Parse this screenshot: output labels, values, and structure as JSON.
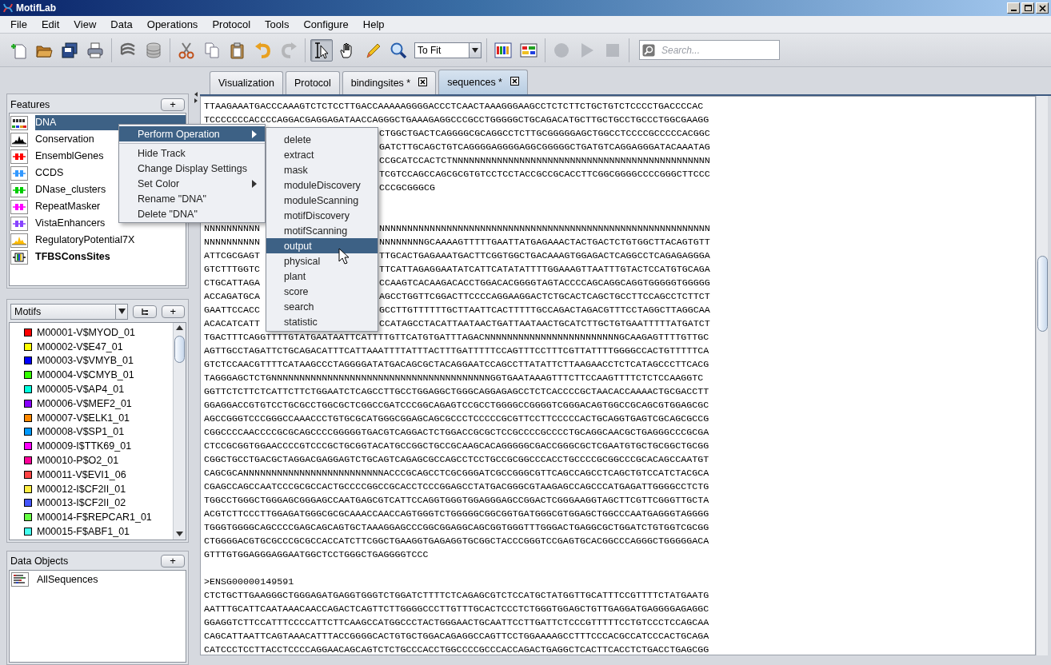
{
  "window": {
    "title": "MotifLab"
  },
  "menu_bar": [
    "File",
    "Edit",
    "View",
    "Data",
    "Operations",
    "Protocol",
    "Tools",
    "Configure",
    "Help"
  ],
  "toolbar": {
    "groups": [
      {
        "items": [
          {
            "kind": "new",
            "disabled": false
          },
          {
            "kind": "open",
            "disabled": false
          },
          {
            "kind": "save",
            "disabled": false
          },
          {
            "kind": "print",
            "disabled": false
          }
        ]
      },
      {
        "items": [
          {
            "kind": "layers",
            "disabled": false
          },
          {
            "kind": "database",
            "disabled": false
          }
        ]
      },
      {
        "items": [
          {
            "kind": "cut",
            "disabled": false
          },
          {
            "kind": "copy",
            "disabled": false
          },
          {
            "kind": "paste",
            "disabled": false
          },
          {
            "kind": "undo",
            "disabled": false
          },
          {
            "kind": "redo",
            "disabled": true
          }
        ]
      },
      {
        "items": [
          {
            "kind": "select",
            "selected": true
          },
          {
            "kind": "hand",
            "selected": false
          },
          {
            "kind": "pencil",
            "selected": false
          },
          {
            "kind": "zoom",
            "selected": false
          }
        ],
        "dropdown": {
          "value": "To Fit"
        }
      },
      {
        "items": [
          {
            "kind": "color_bars",
            "disabled": false
          },
          {
            "kind": "tracks",
            "disabled": false
          }
        ]
      },
      {
        "items": [
          {
            "kind": "record",
            "disabled": true
          },
          {
            "kind": "play",
            "disabled": true
          },
          {
            "kind": "stop",
            "disabled": true
          }
        ]
      }
    ],
    "search": {
      "placeholder": "Search..."
    }
  },
  "tabs": [
    {
      "label": "Visualization",
      "selected": false,
      "closable": false
    },
    {
      "label": "Protocol",
      "selected": false,
      "closable": false
    },
    {
      "label": "bindingsites *",
      "selected": false,
      "closable": true
    },
    {
      "label": "sequences *",
      "selected": true,
      "closable": true
    }
  ],
  "features": {
    "title": "Features",
    "add_button": "+",
    "items": [
      {
        "name": "DNA",
        "kind": "sequence",
        "selected": true,
        "bold": false
      },
      {
        "name": "Conservation",
        "kind": "numeric",
        "color": "#000000",
        "selected": false,
        "bold": false
      },
      {
        "name": "EnsemblGenes",
        "kind": "region",
        "color": "#ff0000",
        "selected": false,
        "bold": false
      },
      {
        "name": "CCDS",
        "kind": "region",
        "color": "#3399ff",
        "selected": false,
        "bold": false
      },
      {
        "name": "DNase_clusters",
        "kind": "region",
        "color": "#00cc00",
        "selected": false,
        "bold": false
      },
      {
        "name": "RepeatMasker",
        "kind": "region",
        "color": "#ff00ff",
        "selected": false,
        "bold": false
      },
      {
        "name": "VistaEnhancers",
        "kind": "region",
        "color": "#8844ff",
        "selected": false,
        "bold": false
      },
      {
        "name": "RegulatoryPotential7X",
        "kind": "numeric",
        "color": "#ffbb00",
        "selected": false,
        "bold": false
      },
      {
        "name": "TFBSConsSites",
        "kind": "motif_track",
        "selected": false,
        "bold": true
      }
    ]
  },
  "motifs": {
    "selector": {
      "value": "Motifs"
    },
    "add_button": "+",
    "items": [
      {
        "name": "M00001-V$MYOD_01",
        "color": "#ff0000"
      },
      {
        "name": "M00002-V$E47_01",
        "color": "#ffff00"
      },
      {
        "name": "M00003-V$VMYB_01",
        "color": "#0000ff"
      },
      {
        "name": "M00004-V$CMYB_01",
        "color": "#33ff00"
      },
      {
        "name": "M00005-V$AP4_01",
        "color": "#00ffdd"
      },
      {
        "name": "M00006-V$MEF2_01",
        "color": "#8800ff"
      },
      {
        "name": "M00007-V$ELK1_01",
        "color": "#ff8800"
      },
      {
        "name": "M00008-V$SP1_01",
        "color": "#0099ff"
      },
      {
        "name": "M00009-I$TTK69_01",
        "color": "#ff00ff"
      },
      {
        "name": "M00010-P$O2_01",
        "color": "#ff0099"
      },
      {
        "name": "M00011-V$EVI1_06",
        "color": "#ff4444"
      },
      {
        "name": "M00012-I$CF2II_01",
        "color": "#ffee44"
      },
      {
        "name": "M00013-I$CF2II_02",
        "color": "#4455ff"
      },
      {
        "name": "M00014-F$REPCAR1_01",
        "color": "#66ff44"
      },
      {
        "name": "M00015-F$ABF1_01",
        "color": "#44ffee"
      }
    ]
  },
  "data_objects": {
    "title": "Data Objects",
    "add_button": "+",
    "items": [
      {
        "name": "AllSequences",
        "kind": "sequence_collection"
      }
    ]
  },
  "sequence_view": {
    "lines": [
      {
        "kind": "full",
        "text": "TTAAGAAATGACCCAAAGTCTCTCCTTGACCAAAAAGGGGACCCTCAACTAAAGGGAAGCCTCTCTTCTGCTGTCTCCCCTGACCCCAC"
      },
      {
        "kind": "full",
        "text": "TCCCCCCCACCCCAGGACGAGGAGATAACCAGGGCTGAAAGAGGCCCGCCTGGGGGCTGCAGACATGCTTGCTGCCTGCCCTGGCGAAGG"
      },
      {
        "kind": "split",
        "right": "CTGGCTGACTCAGGGGCGCAGGCCTCTTGCGGGGGAGCTGGCCTCCCCGCCCCCACGGC"
      },
      {
        "kind": "split",
        "right": "GATCTTGCAGCTGTCAGGGGAGGGGAGGCGGGGGCTGATGTCAGGAGGGATACAAATAG"
      },
      {
        "kind": "split",
        "right": "CCGCATCCACTCTNNNNNNNNNNNNNNNNNNNNNNNNNNNNNNNNNNNNNNNNNNNNNN"
      },
      {
        "kind": "split",
        "right": "TCGTCCAGCCAGCGCGTGTCCTCCTACCGCCGCACCTTCGGCGGGGCCCCGGGCTTCCC"
      },
      {
        "kind": "split",
        "right": "CCCGCGGGCG"
      },
      {
        "kind": "blank"
      },
      {
        "kind": "blank"
      },
      {
        "kind": "split",
        "left": "NNNNNNNNNN",
        "right": "NNNNNNNNNNNNNNNNNNNNNNNNNNNNNNNNNNNNNNNNNNNNNNNNNNNNNNNNNNN"
      },
      {
        "kind": "split",
        "left": "NNNNNNNNNN",
        "right": "NNNNNNNNGCAAAAGTTTTTGAATTATGAGAAACTACTGACTCTGTGGCTTACAGTGTT"
      },
      {
        "kind": "split",
        "left": "ATTCGCGAGT",
        "right": "TTGCACTGAGAAATGACTTCGGTGGCTGACAAAGTGGAGACTCAGGCCTCAGAGAGGGA"
      },
      {
        "kind": "split",
        "left": "GTCTTTGGTC",
        "right": "TTCATTAGAGGAATATCATTCATATATTTTGGAAAGTTAATTTGTACTCCATGTGCAGA"
      },
      {
        "kind": "split",
        "left": "CTGCATTAGA",
        "right": "CCAAGTCACAAGACACCTGGACACGGGGTAGTACCCCAGCAGGCAGGTGGGGGTGGGGG"
      },
      {
        "kind": "split",
        "left": "ACCAGATGCA",
        "right": "AGCCTGGTTCGGACTTCCCCAGGAAGGACTCTGCACTCAGCTGCCTTCCAGCCTCTTCT"
      },
      {
        "kind": "split",
        "left": "GAATTCCACC",
        "right": "GCCTTGTTTTTTGCTTAATTCACTTTTTGCCAGACTAGACGTTTCCTAGGCTTAGGCAA"
      },
      {
        "kind": "split",
        "left": "ACACATCATT",
        "right": "CCATAGCCTACATTAATAACTGATTAATAACTGCATCTTGCTGTGAATTTTTATGATCT"
      },
      {
        "kind": "full",
        "text": "TGACTTTCAGGTTTTGTATGAATAATTCATTTTGTTCATGTGATTTAGACNNNNNNNNNNNNNNNNNNNNNNNNGCAAGAGTTTTGTTGC"
      },
      {
        "kind": "full",
        "text": "AGTTGCCTAGATTCTGCAGACATTTCATTAAATTTTATTTACTTTGATTTTTCCAGTTTCCTTTCGTTATTTTGGGGCCACTGTTTTTCA"
      },
      {
        "kind": "full",
        "text": "GTCTCCAACGTTTTCATAAGCCCTAGGGGATATGACAGCGCTACAGGAATCCAGCCTTATATTCTTAAGAACCTCTCATAGCCCTTCACG"
      },
      {
        "kind": "full",
        "text": "TAGGGAGCTCTGNNNNNNNNNNNNNNNNNNNNNNNNNNNNNNNNNNNNNNNGGTGAATAAAGTTTCTTCCAAGTTTTCTCTCCAAGGTC"
      },
      {
        "kind": "full",
        "text": "GGTTCTCTTCTCATTCTTCTGGAATCTCAGCCTTGCCTGGAGGCTGGGCAGGAGAGCCTCTCACCCCGCTAACACCAAAACTGCGACCTT"
      },
      {
        "kind": "full",
        "text": "GGAGGACCGTGTCCTGCGCCTGGCGCTCGGCCGATCCCGGCAGAGTCCGCCTGGGGCCGGGGTCGGGACAGTGGCCGCAGCGTGGAGCGC"
      },
      {
        "kind": "full",
        "text": "AGCCGGGTCCCGGGCCAAACCCTGTGCGCATGGGCGGAGCAGCGCCCTCCCCCGCGTTCCTTCCCCCACTGCAGGTGAGTCGCAGCGCCG"
      },
      {
        "kind": "full",
        "text": "CGGCCCCAACCCCGCGCAGCCCCGGGGGTGACGTCAGGACTCTGGACCGCGCTCCGCCCCGCCCCTGCAGGCAACGCTGAGGGCCCGCGA"
      },
      {
        "kind": "full",
        "text": "CTCCGCGGTGGAACCCCGTCCCGCTGCGGTACATGCCGGCTGCCGCAAGCACAGGGGGCGACCGGGCGCTCGAATGTGCTGCGGCTGCGG"
      },
      {
        "kind": "full",
        "text": "CGGCTGCCTGACGCTAGGACGAGGAGTCTGCAGTCAGAGCGCCAGCCTCCTGCCGCGGCCCACCTGCCCCGCGGCCCGCACAGCCAATGT"
      },
      {
        "kind": "full",
        "text": "CAGCGCANNNNNNNNNNNNNNNNNNNNNNNNNACCCGCAGCCTCGCGGGATCGCCGGGCGTTCAGCCAGCCTCAGCTGTCCATCTACGCA"
      },
      {
        "kind": "full",
        "text": "CGAGCCAGCCAATCCCGCGCCACTGCCCCGGCCGCACCTCCCGGAGCCTATGACGGGCGTAAGAGCCAGCCCATGAGATTGGGGCCTCTG"
      },
      {
        "kind": "full",
        "text": "TGGCCTGGGCTGGGAGCGGGAGCCAATGAGCGTCATTCCAGGTGGGTGGAGGGAGCCGGACTCGGGAAGGTAGCTTCGTTCGGGTTGCTA"
      },
      {
        "kind": "full",
        "text": "ACGTCTTCCCTTGGAGATGGGCGCGCAAACCAACCAGTGGGTCTGGGGGCGGCGGTGATGGGCGTGGAGCTGGCCCAATGAGGGTAGGGG"
      },
      {
        "kind": "full",
        "text": "TGGGTGGGGCAGCCCCGAGCAGCAGTGCTAAAGGAGCCCGGCGGAGGCAGCGGTGGGTTTGGGACTGAGGCGCTGGATCTGTGGTCGCGG"
      },
      {
        "kind": "full",
        "text": "CTGGGGACGTGCGCCCGCGCCACCATCTTCGGCTGAAGGTGAGAGGTGCGGCTACCCGGGTCCGAGTGCACGGCCCAGGGCTGGGGGACA"
      },
      {
        "kind": "full",
        "text": "GTTTGTGGAGGGAGGAATGGCTCCTGGGCTGAGGGGTCCC"
      },
      {
        "kind": "blank"
      },
      {
        "kind": "header",
        "text": ">ENSG00000149591"
      },
      {
        "kind": "full",
        "text": "CTCTGCTTGAAGGGCTGGGAGATGAGGTGGGTCTGGATCTTTTCTCAGAGCGTCTCCATGCTATGGTTGCATTTCCGTTTTCTATGAATG"
      },
      {
        "kind": "full",
        "text": "AATTTGCATTCAATAAACAACCAGACTCAGTTCTTGGGGCCCTTGTTTGCACTCCCTCTGGGTGGAGCTGTTGAGGATGAGGGGAGAGGC"
      },
      {
        "kind": "full",
        "text": "GGAGGTCTTCCATTTCCCCATTCTTCAAGCCATGGCCCTACTGGGAACTGCAATTCCTTGATTCTCCCGTTTTTCCTGTCCCTCCAGCAA"
      },
      {
        "kind": "full",
        "text": "CAGCATTAATTCAGTAAACATTTACCGGGGCACTGTGCTGGACAGAGGCCAGTTCCTGGAAAAGCCTTTCCCACGCCATCCCACTGCAGA"
      },
      {
        "kind": "full",
        "text": "CATCCCTCCTTACCTCCCCAGGAACAGCAGTCTCTGCCCACCTGGCCCCGCCCACCAGACTGAGGCTCACTTCACCTCTGACCTGAGCGG"
      }
    ]
  },
  "context_menu": {
    "items": [
      {
        "kind": "item",
        "label": "Perform Operation",
        "selected": true,
        "has_submenu": true
      },
      {
        "kind": "separator"
      },
      {
        "kind": "item",
        "label": "Hide Track",
        "selected": false,
        "has_submenu": false
      },
      {
        "kind": "item",
        "label": "Change Display Settings",
        "selected": false,
        "has_submenu": false
      },
      {
        "kind": "item",
        "label": "Set Color",
        "selected": false,
        "has_submenu": true
      },
      {
        "kind": "item",
        "label": "Rename \"DNA\"",
        "selected": false,
        "has_submenu": false
      },
      {
        "kind": "item",
        "label": "Delete \"DNA\"",
        "selected": false,
        "has_submenu": false
      }
    ]
  },
  "submenu": {
    "items": [
      {
        "label": "delete",
        "selected": false
      },
      {
        "label": "extract",
        "selected": false
      },
      {
        "label": "mask",
        "selected": false
      },
      {
        "label": "moduleDiscovery",
        "selected": false
      },
      {
        "label": "moduleScanning",
        "selected": false
      },
      {
        "label": "motifDiscovery",
        "selected": false
      },
      {
        "label": "motifScanning",
        "selected": false
      },
      {
        "label": "output",
        "selected": true
      },
      {
        "label": "physical",
        "selected": false
      },
      {
        "label": "plant",
        "selected": false
      },
      {
        "label": "score",
        "selected": false
      },
      {
        "label": "search",
        "selected": false
      },
      {
        "label": "statistic",
        "selected": false
      }
    ]
  }
}
